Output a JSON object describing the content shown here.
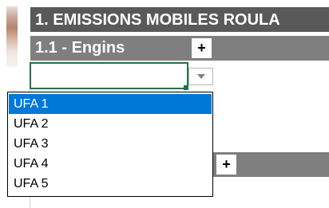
{
  "sheet": {
    "section_title": "1. EMISSIONS MOBILES ROULA",
    "subsection_title": "1.1 - Engins",
    "add_label_1": "+",
    "add_label_2": "+",
    "combo_value": ""
  },
  "dropdown": {
    "options": [
      "UFA 1",
      "UFA 2",
      "UFA 3",
      "UFA 4",
      "UFA 5"
    ],
    "selected_index": 0
  },
  "colors": {
    "header_dark": "#595959",
    "header_mid": "#7f7f7f",
    "selection": "#0078d7",
    "active_cell_border": "#217346"
  },
  "icons": {
    "dropdown_button": "chevron-down-icon",
    "photo": "person-photo"
  }
}
